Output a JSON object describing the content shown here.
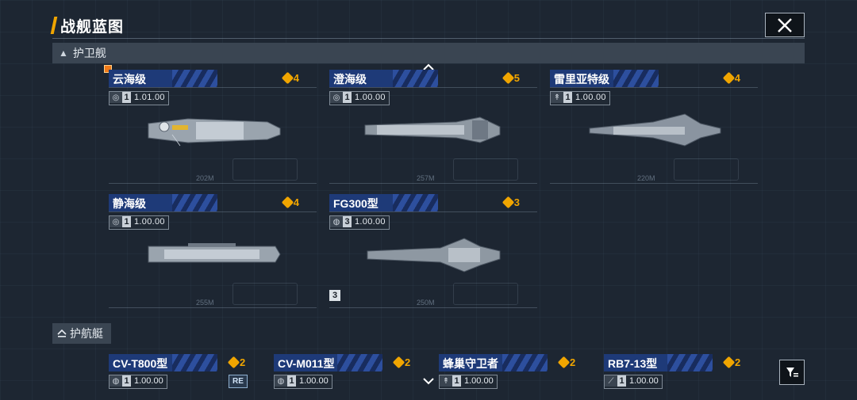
{
  "title": "战舰蓝图",
  "frigate_section": {
    "label": "护卫舰"
  },
  "frigates": [
    {
      "name": "云海级",
      "cost": "4",
      "ratio": "1.01.00",
      "tier": "1",
      "length": "202M",
      "type_icon": "ring-icon"
    },
    {
      "name": "澄海级",
      "cost": "5",
      "ratio": "1.00.00",
      "tier": "1",
      "length": "257M",
      "type_icon": "ring-icon"
    },
    {
      "name": "雷里亚特级",
      "cost": "4",
      "ratio": "1.00.00",
      "tier": "1",
      "length": "220M",
      "type_icon": "missile-icon"
    },
    {
      "name": "静海级",
      "cost": "4",
      "ratio": "1.00.00",
      "tier": "1",
      "length": "255M",
      "type_icon": "ring-icon"
    },
    {
      "name": "FG300型",
      "cost": "3",
      "ratio": "1.00.00",
      "tier": "3",
      "length": "250M",
      "type_icon": "globe-icon"
    }
  ],
  "count_badge": "3",
  "escort_section": {
    "label": "护航艇"
  },
  "escorts": [
    {
      "name": "CV-T800型",
      "cost": "2",
      "ratio": "1.00.00",
      "tier": "1",
      "type_icon": "globe-icon"
    },
    {
      "name": "CV-M011型",
      "cost": "2",
      "ratio": "1.00.00",
      "tier": "1",
      "type_icon": "globe-icon"
    },
    {
      "name": "蜂巢守卫者",
      "cost": "2",
      "ratio": "1.00.00",
      "tier": "1",
      "type_icon": "missile-icon"
    },
    {
      "name": "RB7-13型",
      "cost": "2",
      "ratio": "1.00.00",
      "tier": "1",
      "type_icon": "wing-icon"
    }
  ],
  "re_badge": "RE",
  "icons": {
    "close": "close-icon",
    "filter": "filter-icon",
    "scroll_up": "chevron-up-icon",
    "scroll_down": "chevron-down-icon"
  },
  "colors": {
    "accent": "#f0a500",
    "name_tab": "#1e3a78",
    "selected": "#f07a18"
  }
}
